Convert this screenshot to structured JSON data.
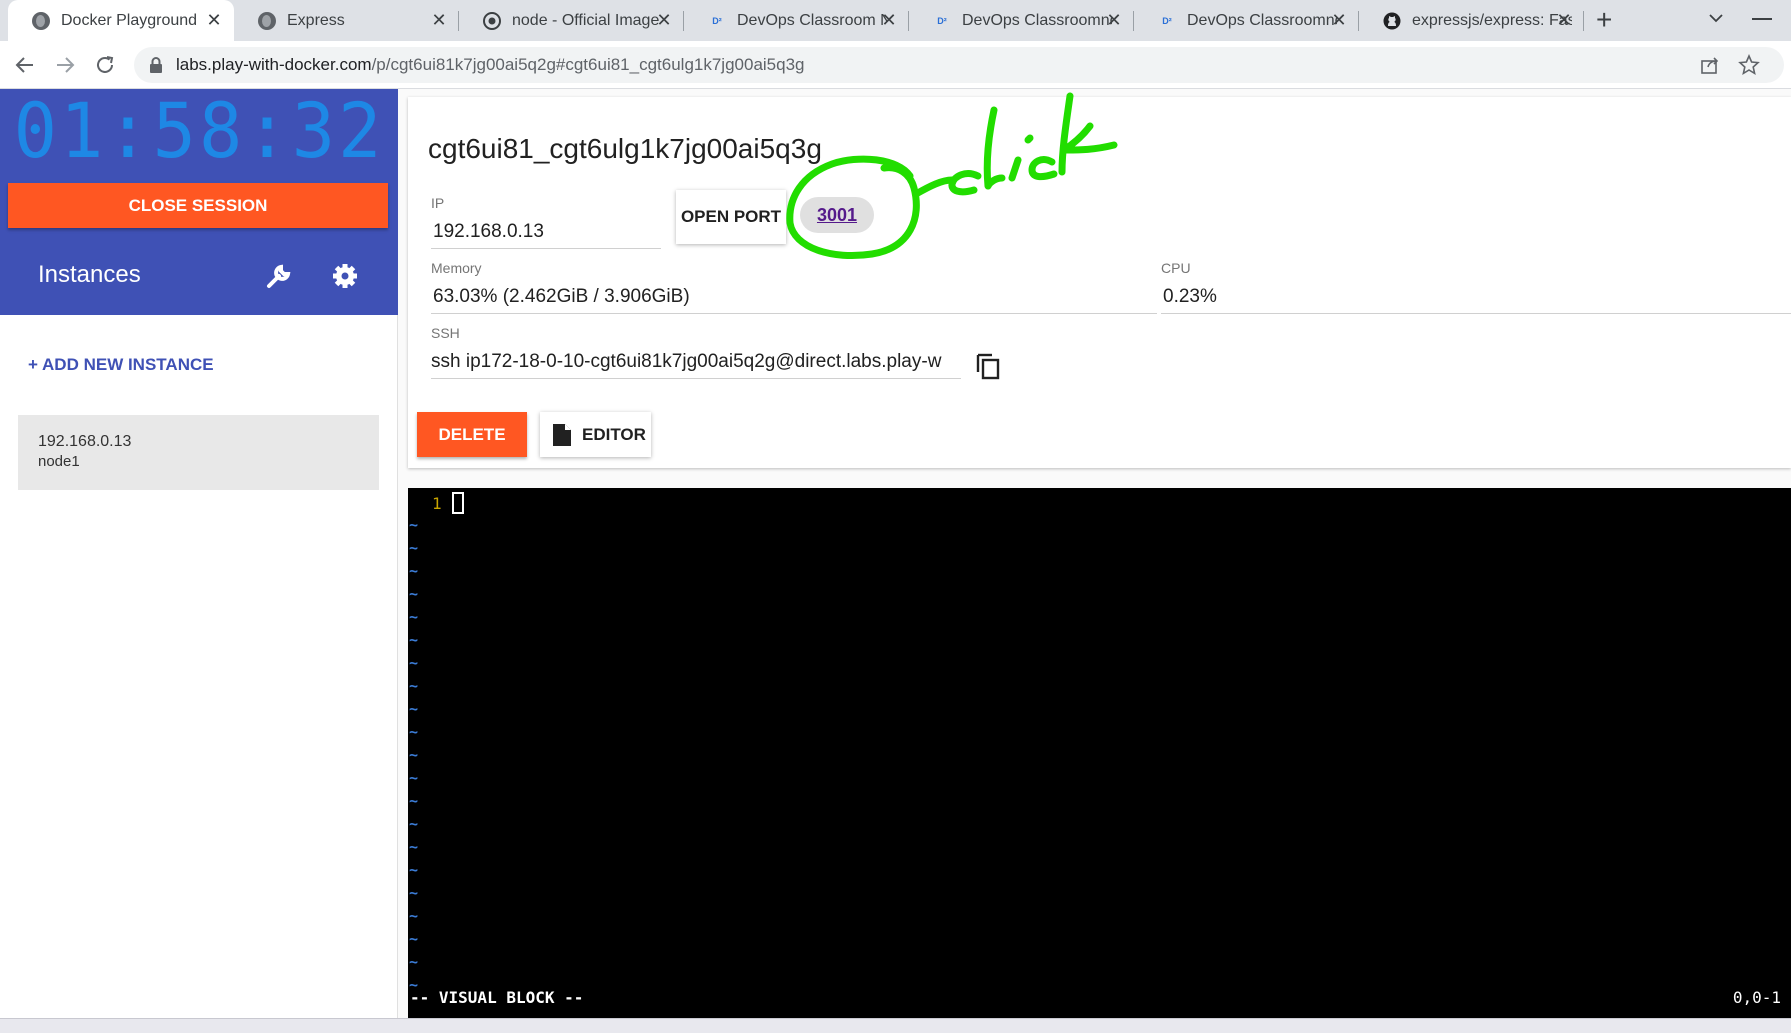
{
  "browser": {
    "tabs": [
      {
        "title": "Docker Playground",
        "icon": "globe-icon",
        "active": true
      },
      {
        "title": "Express",
        "icon": "globe-icon",
        "active": false
      },
      {
        "title": "node - Official Image",
        "icon": "docker-hub-icon",
        "active": false
      },
      {
        "title": "DevOps Classroom No",
        "icon": "devops-icon",
        "active": false
      },
      {
        "title": "DevOps Classroomnot",
        "icon": "devops-icon",
        "active": false
      },
      {
        "title": "DevOps Classroomno",
        "icon": "devops-icon",
        "active": false
      },
      {
        "title": "expressjs/express: Fas",
        "icon": "github-icon",
        "active": false
      }
    ],
    "new_tab_label": "+",
    "url_host": "labs.play-with-docker.com",
    "url_path": "/p/cgt6ui81k7jg00ai5q2g#cgt6ui81_cgt6ulg1k7jg00ai5q3g"
  },
  "sidebar": {
    "timer": "01:58:32",
    "close_session_label": "CLOSE SESSION",
    "instances_title": "Instances",
    "add_instance_label": "+ ADD NEW INSTANCE",
    "instance": {
      "ip": "192.168.0.13",
      "name": "node1"
    }
  },
  "instance_panel": {
    "hostname": "cgt6ui81_cgt6ulg1k7jg00ai5q3g",
    "ip_label": "IP",
    "ip_value": "192.168.0.13",
    "open_port_label": "OPEN PORT",
    "port_link": "3001",
    "memory_label": "Memory",
    "memory_value": "63.03% (2.462GiB / 3.906GiB)",
    "cpu_label": "CPU",
    "cpu_value": "0.23%",
    "ssh_label": "SSH",
    "ssh_value": "ssh ip172-18-0-10-cgt6ui81k7jg00ai5q2g@direct.labs.play-w",
    "delete_label": "DELETE",
    "editor_label": "EDITOR"
  },
  "terminal": {
    "line_number": "1",
    "empty_line_marker": "~",
    "empty_line_count": 21,
    "mode": "-- VISUAL BLOCK --",
    "position": "0,0-1"
  },
  "annotation": {
    "text": "click",
    "color": "#22dd00"
  },
  "colors": {
    "sidebar_blue": "#3f51b5",
    "timer_blue": "#1e88e5",
    "accent_orange": "#ff5722"
  }
}
